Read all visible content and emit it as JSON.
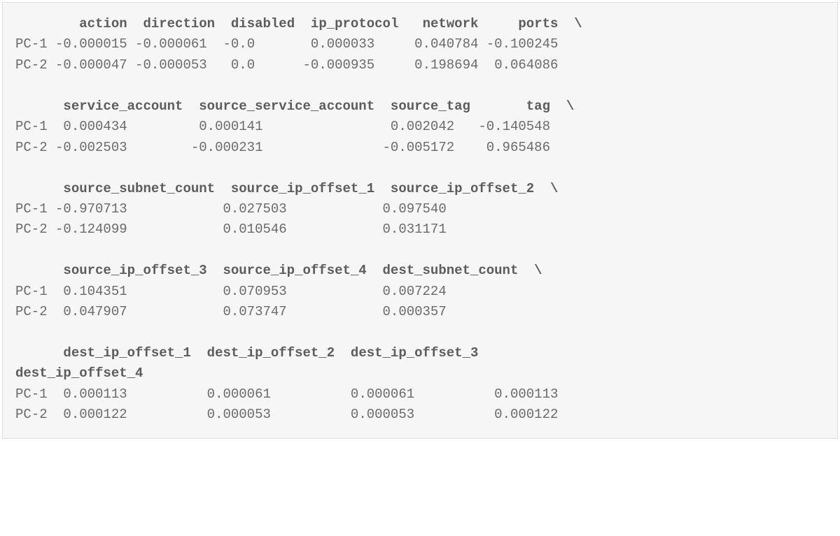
{
  "font_family": "monospace",
  "colors": {
    "background": "#f6f6f6",
    "border": "#dedede",
    "text": "#6a6a6a",
    "header": "#5c5c5c"
  },
  "row_labels": [
    "PC-1",
    "PC-2"
  ],
  "continuation": "\\",
  "groups": [
    {
      "headers": [
        "action",
        "direction",
        "disabled",
        "ip_protocol",
        "network",
        "ports"
      ],
      "has_continuation": true,
      "rows": [
        [
          "-0.000015",
          "-0.000061",
          "-0.0",
          "0.000033",
          "0.040784",
          "-0.100245"
        ],
        [
          "-0.000047",
          "-0.000053",
          "0.0",
          "-0.000935",
          "0.198694",
          "0.064086"
        ]
      ]
    },
    {
      "headers": [
        "service_account",
        "source_service_account",
        "source_tag",
        "tag"
      ],
      "has_continuation": true,
      "rows": [
        [
          "0.000434",
          "0.000141",
          "0.002042",
          "-0.140548"
        ],
        [
          "-0.002503",
          "-0.000231",
          "-0.005172",
          "0.965486"
        ]
      ]
    },
    {
      "headers": [
        "source_subnet_count",
        "source_ip_offset_1",
        "source_ip_offset_2"
      ],
      "has_continuation": true,
      "rows": [
        [
          "-0.970713",
          "0.027503",
          "0.097540"
        ],
        [
          "-0.124099",
          "0.010546",
          "0.031171"
        ]
      ]
    },
    {
      "headers": [
        "source_ip_offset_3",
        "source_ip_offset_4",
        "dest_subnet_count"
      ],
      "has_continuation": true,
      "rows": [
        [
          "0.104351",
          "0.070953",
          "0.007224"
        ],
        [
          "0.047907",
          "0.073747",
          "0.000357"
        ]
      ]
    },
    {
      "headers": [
        "dest_ip_offset_1",
        "dest_ip_offset_2",
        "dest_ip_offset_3",
        "dest_ip_offset_4"
      ],
      "wrap_last_header": true,
      "has_continuation": false,
      "rows": [
        [
          "0.000113",
          "0.000061",
          "0.000061",
          "0.000113"
        ],
        [
          "0.000122",
          "0.000053",
          "0.000053",
          "0.000122"
        ]
      ]
    }
  ]
}
